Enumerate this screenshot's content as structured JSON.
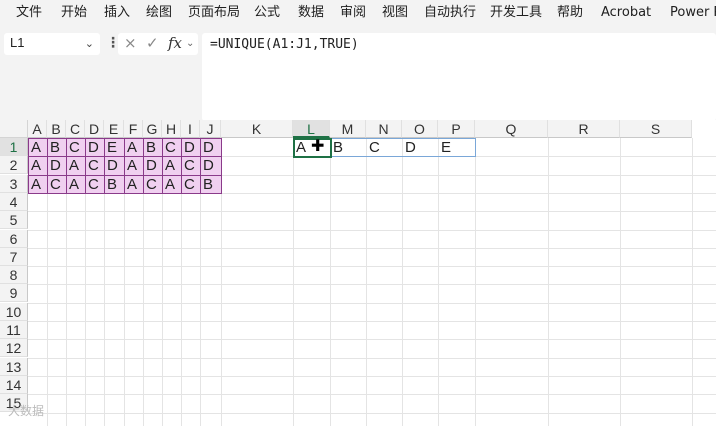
{
  "menu": [
    "文件",
    "开始",
    "插入",
    "绘图",
    "页面布局",
    "公式",
    "数据",
    "审阅",
    "视图",
    "自动执行",
    "开发工具",
    "帮助",
    "Acrobat",
    "Power P"
  ],
  "name_box": {
    "value": "L1"
  },
  "formula_bar": {
    "value": "=UNIQUE(A1:J1,TRUE)",
    "cancel_icon": "×",
    "enter_icon": "✓",
    "fx_label": "fx"
  },
  "columns": [
    "A",
    "B",
    "C",
    "D",
    "E",
    "F",
    "G",
    "H",
    "I",
    "J",
    "K",
    "L",
    "M",
    "N",
    "O",
    "P",
    "Q",
    "R",
    "S"
  ],
  "rows": [
    "1",
    "2",
    "3",
    "4",
    "5",
    "6",
    "7",
    "8",
    "9",
    "10",
    "11",
    "12",
    "13",
    "14",
    "15"
  ],
  "source_data": [
    [
      "A",
      "B",
      "C",
      "D",
      "E",
      "A",
      "B",
      "C",
      "D",
      "D"
    ],
    [
      "A",
      "D",
      "A",
      "C",
      "D",
      "A",
      "D",
      "A",
      "C",
      "D"
    ],
    [
      "A",
      "C",
      "A",
      "C",
      "B",
      "A",
      "C",
      "A",
      "C",
      "B"
    ]
  ],
  "unique_result": [
    "A",
    "B",
    "C",
    "D",
    "E"
  ],
  "active_column": "L",
  "active_row": "1",
  "colors": {
    "source_fill": "#f0d0f0",
    "source_border": "#8a3a8a",
    "selection": "#1e7145"
  },
  "watermark": "大数据"
}
